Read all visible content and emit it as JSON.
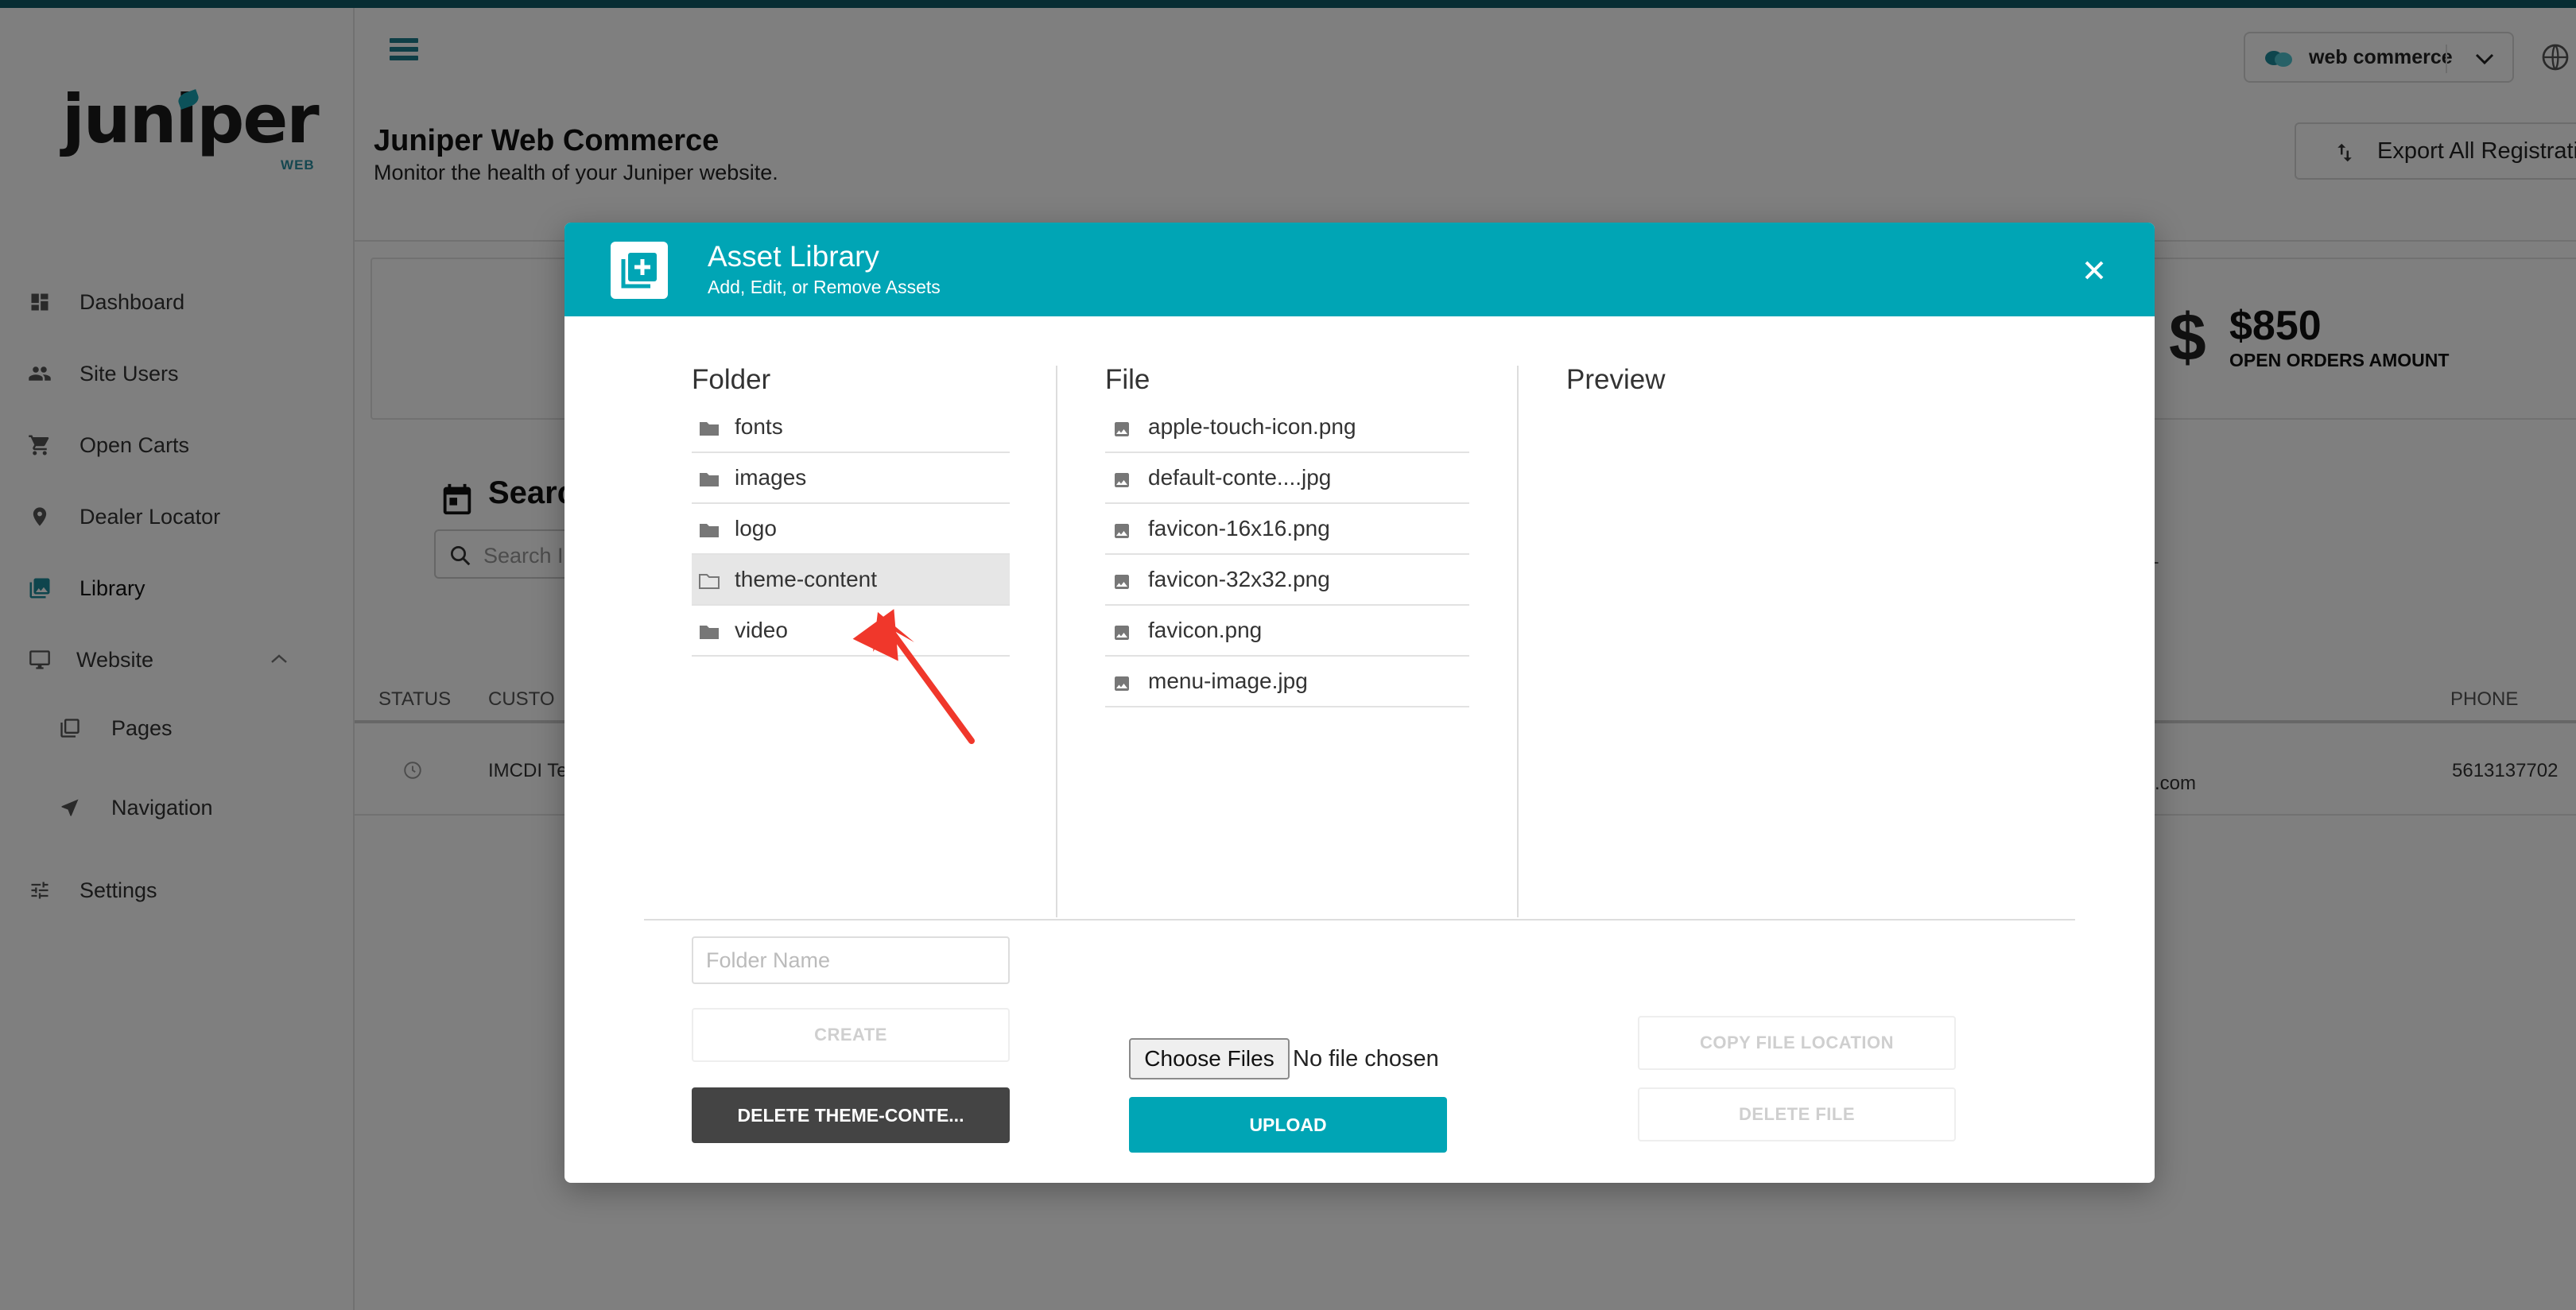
{
  "brand": {
    "logo_word": "juniper",
    "logo_sub": "WEB"
  },
  "sidebar": {
    "items": [
      {
        "label": "Dashboard",
        "icon": "dashboard-icon"
      },
      {
        "label": "Site Users",
        "icon": "people-icon"
      },
      {
        "label": "Open Carts",
        "icon": "cart-icon"
      },
      {
        "label": "Dealer Locator",
        "icon": "location-pin-icon"
      },
      {
        "label": "Library",
        "icon": "library-icon"
      },
      {
        "label": "Website",
        "icon": "monitor-icon"
      },
      {
        "label": "Pages",
        "icon": "pages-icon"
      },
      {
        "label": "Navigation",
        "icon": "navigation-arrow-icon"
      },
      {
        "label": "Settings",
        "icon": "sliders-icon"
      }
    ]
  },
  "header": {
    "title": "Juniper Web Commerce",
    "subtitle": "Monitor the health of your Juniper website.",
    "tenant": "web commerce",
    "export_label": "Export All Registratio"
  },
  "stats": {
    "amount": "$850",
    "amount_label": "OPEN ORDERS AMOUNT",
    "currency_symbol": "$"
  },
  "search": {
    "title": "Searc",
    "placeholder": "Search I"
  },
  "table": {
    "headers": [
      "STATUS",
      "CUSTO",
      "PHONE"
    ],
    "trailing_char": "L",
    "row": {
      "customer": "IMCDI Te",
      "email": ".com",
      "phone": "5613137702"
    }
  },
  "modal": {
    "title": "Asset Library",
    "subtitle": "Add, Edit, or Remove Assets",
    "folder_header": "Folder",
    "file_header": "File",
    "preview_header": "Preview",
    "folders": [
      {
        "label": "fonts",
        "selected": false
      },
      {
        "label": "images",
        "selected": false
      },
      {
        "label": "logo",
        "selected": false
      },
      {
        "label": "theme-content",
        "selected": true
      },
      {
        "label": "video",
        "selected": false
      }
    ],
    "files": [
      {
        "label": "apple-touch-icon.png"
      },
      {
        "label": "default-conte....jpg"
      },
      {
        "label": "favicon-16x16.png"
      },
      {
        "label": "favicon-32x32.png"
      },
      {
        "label": "favicon.png"
      },
      {
        "label": "menu-image.jpg"
      }
    ],
    "folder_name_placeholder": "Folder Name",
    "create_label": "CREATE",
    "delete_folder_label": "DELETE THEME-CONTE...",
    "choose_files_label": "Choose Files",
    "no_file_text": "No file chosen",
    "upload_label": "UPLOAD",
    "copy_location_label": "COPY FILE LOCATION",
    "delete_file_label": "DELETE FILE"
  },
  "colors": {
    "accent": "#00a5b5",
    "annotation_arrow": "#f0372b",
    "dark_button": "#444444"
  }
}
